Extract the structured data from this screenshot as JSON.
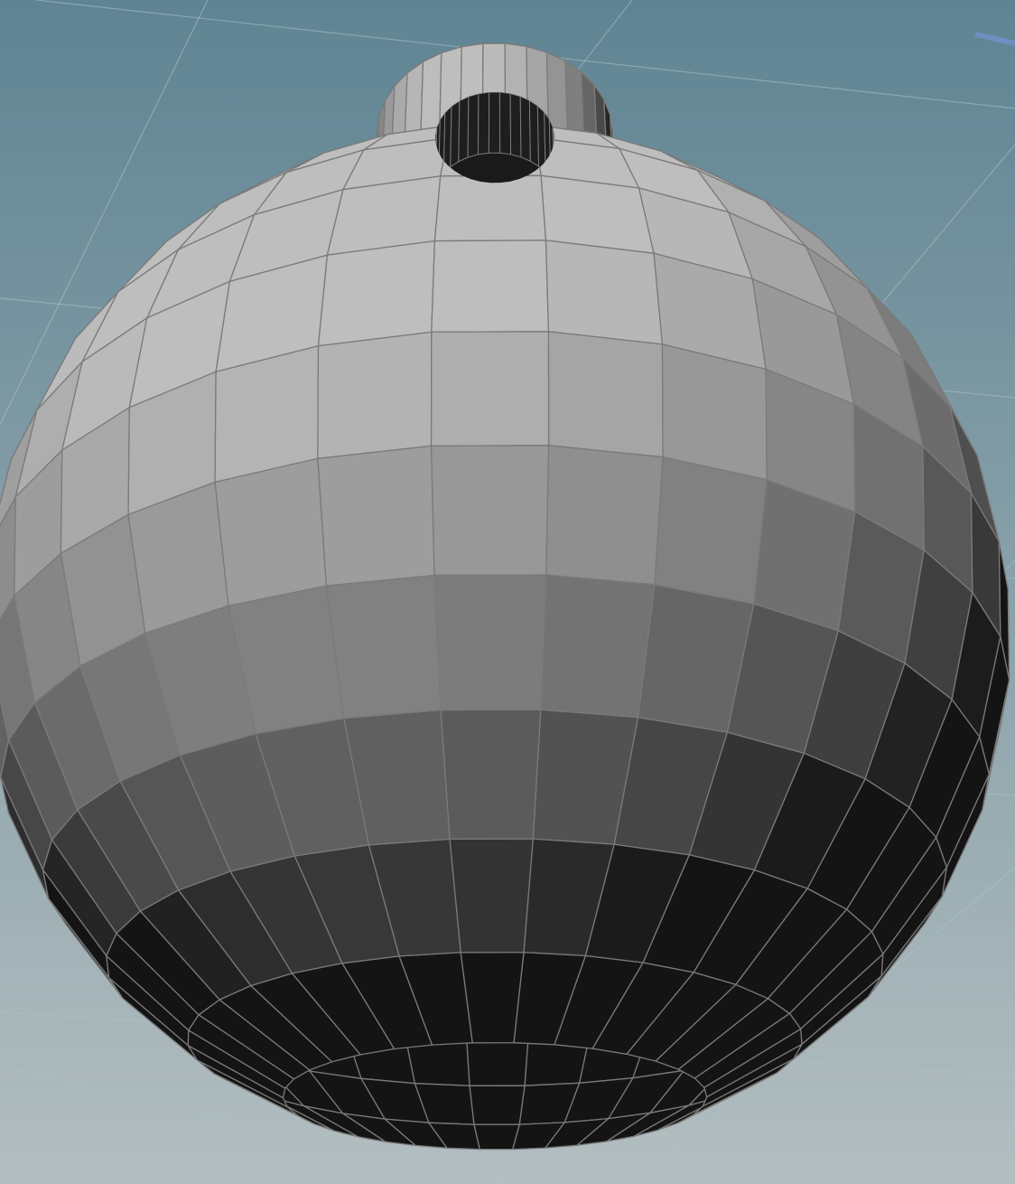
{
  "viewport": {
    "background_top": "#5f8493",
    "background_bottom": "#b3bec0",
    "grid_line_color": "#a9c2c8",
    "handle_color": "#6f8fc0"
  },
  "model": {
    "shape": "sphere with hollow cylindrical neck",
    "render_style": "flat-shaded polygon mesh with visible edges",
    "face_color": "#a8a8a8",
    "shadow_color": "#161616",
    "edge_color": "#7a7a7a",
    "sphere_segments": 36,
    "neck_segments": 36
  }
}
